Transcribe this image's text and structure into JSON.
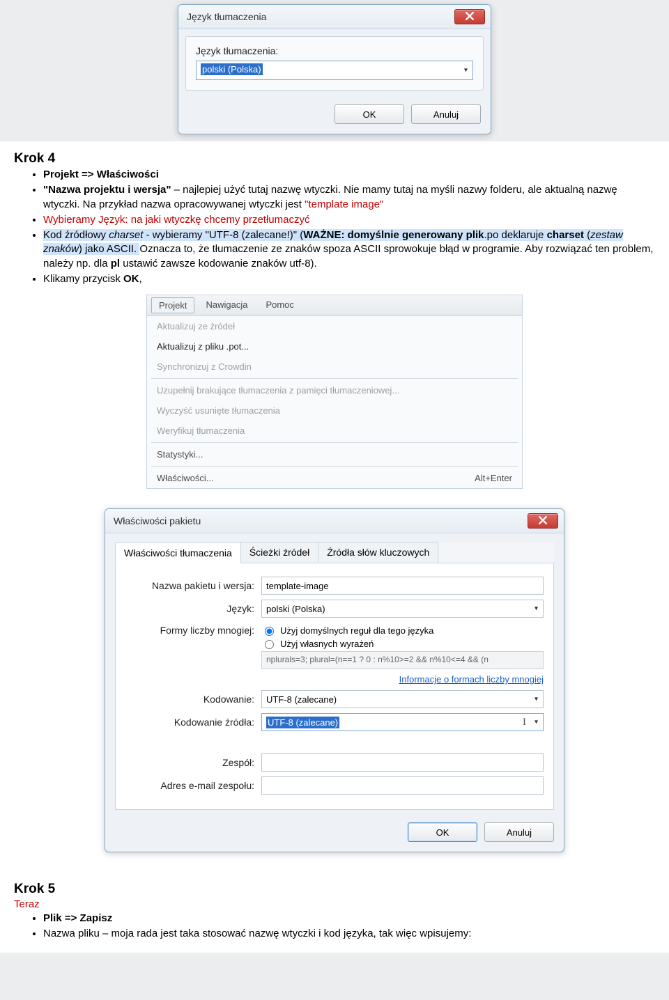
{
  "dialog1": {
    "title": "Język tłumaczenia",
    "label": "Język tłumaczenia:",
    "value": "polski (Polska)",
    "ok": "OK",
    "cancel": "Anuluj"
  },
  "step4": {
    "heading": "Krok 4",
    "b1": "Projekt => Właściwości",
    "b2_pre": "\"Nazwa projektu i wersja\"",
    "b2_mid": " – najlepiej użyć tutaj nazwę wtyczki. Nie mamy tutaj na myśli nazwy folderu, ale aktualną nazwę wtyczki. Na przykład nazwa opracowywanej wtyczki jest ",
    "b2_red": "\"template image\"",
    "b3": "Wybieramy Język: na jaki wtyczkę chcemy przetłumaczyć",
    "b4_pre": "Kod źródłowy ",
    "b4_it": "charset",
    "b4_mid": " - wybieramy \"UTF-8 (zalecane!)\" (",
    "b4_bold1": "WAŻNE: domyślnie generowany plik",
    "b4_after1": ".po deklaruje ",
    "b4_bold2": "charset",
    "b4_after2": " (",
    "b4_it2": "zestaw znaków",
    "b4_after3": ") jako ASCII.",
    "b4_tail": " Oznacza to, że tłumaczenie ze znaków spoza ASCII sprowokuje błąd w programie. Aby rozwiązać ten problem, należy np. dla ",
    "b4_bold3": "pl",
    "b4_tail2": " ustawić zawsze kodowanie znaków utf-8).",
    "b5_pre": "Klikamy przycisk ",
    "b5_bold": "OK",
    "b5_tail": ","
  },
  "menu": {
    "bar": {
      "projekt": "Projekt",
      "nawigacja": "Nawigacja",
      "pomoc": "Pomoc"
    },
    "items": {
      "i1": "Aktualizuj ze źródeł",
      "i2": "Aktualizuj z pliku .pot...",
      "i3": "Synchronizuj z Crowdin",
      "i4": "Uzupełnij brakujące tłumaczenia z pamięci tłumaczeniowej...",
      "i5": "Wyczyść usunięte tłumaczenia",
      "i6": "Weryfikuj tłumaczenia",
      "i7": "Statystyki...",
      "i8": "Właściwości...",
      "i8_shortcut": "Alt+Enter"
    }
  },
  "dialog2": {
    "title": "Właściwości pakietu",
    "tabs": {
      "t1": "Właściwości tłumaczenia",
      "t2": "Ścieżki źródeł",
      "t3": "Źródła słów kluczowych"
    },
    "lbl_name": "Nazwa pakietu i wersja:",
    "val_name": "template-image",
    "lbl_lang": "Język:",
    "val_lang": "polski (Polska)",
    "lbl_plural": "Formy liczby mnogiej:",
    "rb1": "Użyj domyślnych reguł dla tego języka",
    "rb2": "Użyj własnych wyrażeń",
    "plural_expr": "nplurals=3; plural=(n==1 ? 0 : n%10>=2 && n%10<=4 && (n",
    "link": "Informacje o formach liczby mnogiej",
    "lbl_enc": "Kodowanie:",
    "val_enc": "UTF-8 (zalecane)",
    "lbl_src_enc": "Kodowanie źródła:",
    "val_src_enc": "UTF-8 (zalecane)",
    "lbl_team": "Zespół:",
    "lbl_email": "Adres e-mail zespołu:",
    "ok": "OK",
    "cancel": "Anuluj"
  },
  "step5": {
    "heading": "Krok 5",
    "red": "Teraz",
    "b1": "Plik => Zapisz",
    "b2": "Nazwa pliku – moja rada jest taka stosować nazwę wtyczki i kod języka, tak więc wpisujemy:"
  }
}
